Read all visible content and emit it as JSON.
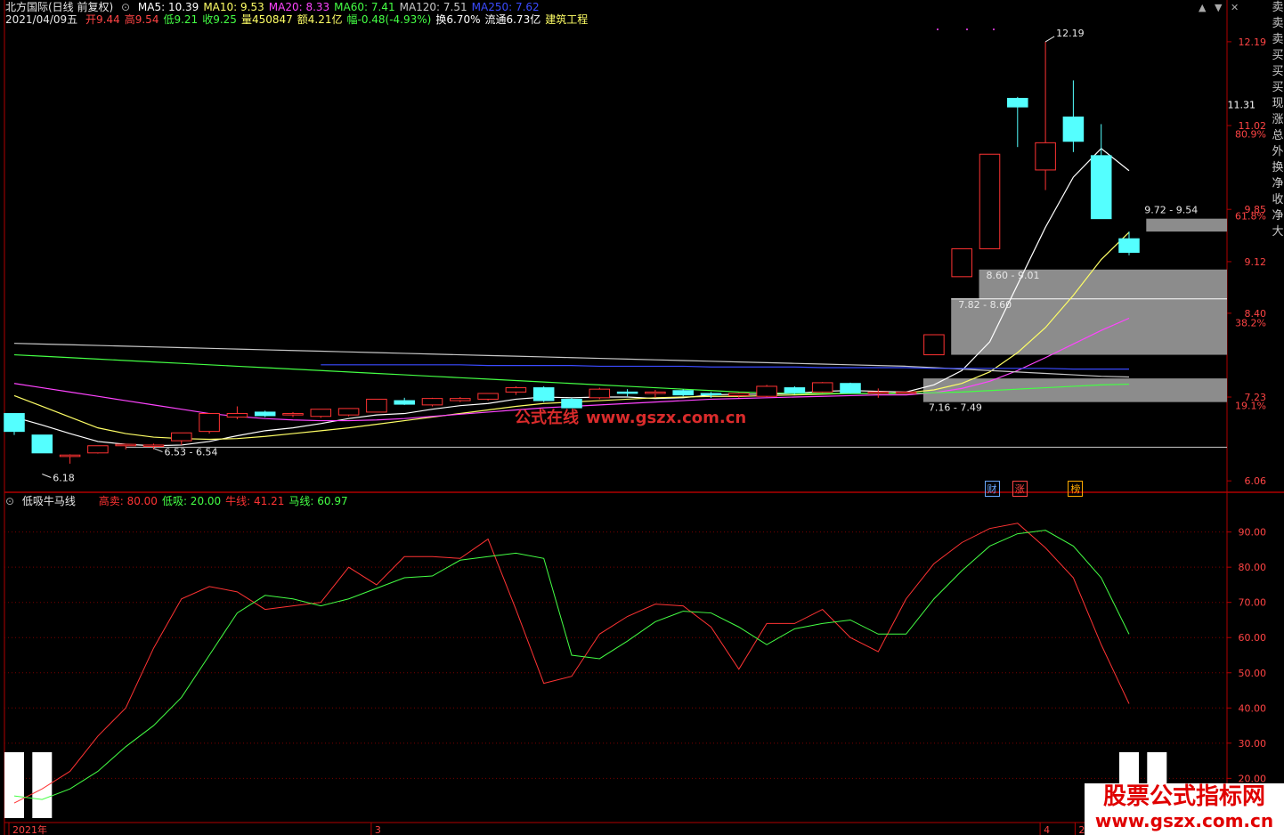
{
  "header": {
    "stock": "北方国际(日线 前复权)",
    "ma": [
      {
        "label": "MA5: 10.39",
        "color": "#ffffff"
      },
      {
        "label": "MA10: 9.53",
        "color": "#ffff66"
      },
      {
        "label": "MA20: 8.33",
        "color": "#ff44ff"
      },
      {
        "label": "MA60: 7.41",
        "color": "#44ff44"
      },
      {
        "label": "MA120: 7.51",
        "color": "#c8c8c8"
      },
      {
        "label": "MA250: 7.62",
        "color": "#3b4bff"
      }
    ],
    "info_date": "2021/04/09五",
    "info": [
      {
        "label": "开9.44",
        "color": "#ff4444"
      },
      {
        "label": "高9.54",
        "color": "#ff4444"
      },
      {
        "label": "低9.21",
        "color": "#44ff44"
      },
      {
        "label": "收9.25",
        "color": "#44ff44"
      },
      {
        "label": "量450847",
        "color": "#ffff66"
      },
      {
        "label": "额4.21亿",
        "color": "#ffff66"
      },
      {
        "label": "幅-0.48(-4.93%)",
        "color": "#44ff44"
      },
      {
        "label": "换6.70%",
        "color": "#ffffff"
      },
      {
        "label": "流通6.73亿",
        "color": "#ffffff"
      },
      {
        "label": "建筑工程",
        "color": "#ffff66"
      }
    ],
    "indicator": {
      "name": "低吸牛马线",
      "items": [
        {
          "label": "高卖: 80.00",
          "color": "#ff3333"
        },
        {
          "label": "低吸: 20.00",
          "color": "#44ff44"
        },
        {
          "label": "牛线: 41.21",
          "color": "#ff3333"
        },
        {
          "label": "马线: 60.97",
          "color": "#44ff44"
        }
      ]
    }
  },
  "right_sidebar": "卖卖卖买买买现涨总外换净收净大",
  "watermarks": {
    "center": "公式在线",
    "center_url": "www.gszx.com.cn",
    "corner_title": "股票公式指标网",
    "corner_url": "www.gszx.com.cn"
  },
  "event_tags": [
    {
      "label": "财",
      "color": "#6aa8ff"
    },
    {
      "label": "涨",
      "color": "#ff4444"
    },
    {
      "label": "榜",
      "color": "#ffaa00"
    }
  ],
  "colors": {
    "up": "#ff3333",
    "down": "#54ffff",
    "axis": "#b00000",
    "zone": "#8c8c8c"
  },
  "chart_data": [
    {
      "type": "candlestick",
      "title": "北方国际(日线 前复权)",
      "y_axis_ticks": [
        12.19,
        11.02,
        9.85,
        9.12,
        8.4,
        7.23,
        6.06
      ],
      "y_axis_current": 11.31,
      "ylim": [
        6.0,
        12.4
      ],
      "pct_ticks": [
        {
          "label": "80.9%",
          "value": 10.9
        },
        {
          "label": "61.8%",
          "value": 9.76
        },
        {
          "label": "38.2%",
          "value": 8.27
        },
        {
          "label": "19.1%",
          "value": 7.11
        }
      ],
      "x_labels": [
        {
          "label": "2021年",
          "index": 0
        },
        {
          "label": "3",
          "index": 13
        },
        {
          "label": "4",
          "index": 37
        },
        {
          "label": "2021/04/02/五",
          "index": 38
        }
      ],
      "candles": [
        {
          "o": 7.0,
          "h": 7.0,
          "l": 6.7,
          "c": 6.75
        },
        {
          "o": 6.7,
          "h": 6.7,
          "l": 6.45,
          "c": 6.45
        },
        {
          "o": 6.4,
          "h": 6.43,
          "l": 6.3,
          "c": 6.42
        },
        {
          "o": 6.45,
          "h": 6.55,
          "l": 6.44,
          "c": 6.55
        },
        {
          "o": 6.55,
          "h": 6.58,
          "l": 6.5,
          "c": 6.57
        },
        {
          "o": 6.56,
          "h": 6.58,
          "l": 6.5,
          "c": 6.56
        },
        {
          "o": 6.62,
          "h": 6.73,
          "l": 6.56,
          "c": 6.73
        },
        {
          "o": 6.75,
          "h": 7.0,
          "l": 6.72,
          "c": 7.0
        },
        {
          "o": 6.95,
          "h": 7.1,
          "l": 6.92,
          "c": 7.0
        },
        {
          "o": 7.02,
          "h": 7.04,
          "l": 6.95,
          "c": 6.97
        },
        {
          "o": 6.98,
          "h": 7.02,
          "l": 6.95,
          "c": 7.0
        },
        {
          "o": 6.96,
          "h": 7.06,
          "l": 6.94,
          "c": 7.06
        },
        {
          "o": 6.98,
          "h": 7.07,
          "l": 6.96,
          "c": 7.07
        },
        {
          "o": 7.02,
          "h": 7.2,
          "l": 7.02,
          "c": 7.2
        },
        {
          "o": 7.18,
          "h": 7.22,
          "l": 7.12,
          "c": 7.13
        },
        {
          "o": 7.12,
          "h": 7.22,
          "l": 7.1,
          "c": 7.21
        },
        {
          "o": 7.18,
          "h": 7.23,
          "l": 7.16,
          "c": 7.21
        },
        {
          "o": 7.2,
          "h": 7.28,
          "l": 7.18,
          "c": 7.28
        },
        {
          "o": 7.3,
          "h": 7.38,
          "l": 7.26,
          "c": 7.36
        },
        {
          "o": 7.36,
          "h": 7.38,
          "l": 7.16,
          "c": 7.18
        },
        {
          "o": 7.2,
          "h": 7.22,
          "l": 7.08,
          "c": 7.08
        },
        {
          "o": 7.22,
          "h": 7.36,
          "l": 7.2,
          "c": 7.34
        },
        {
          "o": 7.3,
          "h": 7.34,
          "l": 7.24,
          "c": 7.29
        },
        {
          "o": 7.28,
          "h": 7.33,
          "l": 7.22,
          "c": 7.3
        },
        {
          "o": 7.32,
          "h": 7.34,
          "l": 7.24,
          "c": 7.26
        },
        {
          "o": 7.28,
          "h": 7.3,
          "l": 7.22,
          "c": 7.27
        },
        {
          "o": 7.25,
          "h": 7.29,
          "l": 7.22,
          "c": 7.28
        },
        {
          "o": 7.24,
          "h": 7.4,
          "l": 7.23,
          "c": 7.38
        },
        {
          "o": 7.36,
          "h": 7.38,
          "l": 7.27,
          "c": 7.29
        },
        {
          "o": 7.3,
          "h": 7.44,
          "l": 7.29,
          "c": 7.43
        },
        {
          "o": 7.42,
          "h": 7.43,
          "l": 7.28,
          "c": 7.29
        },
        {
          "o": 7.3,
          "h": 7.35,
          "l": 7.22,
          "c": 7.3
        },
        {
          "o": 7.3,
          "h": 7.3,
          "l": 7.29,
          "c": 7.3
        },
        {
          "o": 7.82,
          "h": 8.1,
          "l": 7.82,
          "c": 8.1
        },
        {
          "o": 8.91,
          "h": 9.3,
          "l": 8.91,
          "c": 9.3
        },
        {
          "o": 9.3,
          "h": 10.62,
          "l": 9.3,
          "c": 10.62
        },
        {
          "o": 11.4,
          "h": 11.42,
          "l": 10.72,
          "c": 11.28
        },
        {
          "o": 10.4,
          "h": 12.19,
          "l": 10.12,
          "c": 10.78
        },
        {
          "o": 11.14,
          "h": 11.65,
          "l": 10.65,
          "c": 10.8
        },
        {
          "o": 10.6,
          "h": 11.04,
          "l": 9.72,
          "c": 9.72
        },
        {
          "o": 9.44,
          "h": 9.54,
          "l": 9.21,
          "c": 9.25
        }
      ],
      "ma_series": [
        {
          "name": "MA5",
          "color": "#ffffff",
          "start": 0,
          "values": [
            6.95,
            6.84,
            6.72,
            6.61,
            6.57,
            6.55,
            6.56,
            6.61,
            6.69,
            6.76,
            6.8,
            6.86,
            6.93,
            6.98,
            7.0,
            7.06,
            7.11,
            7.14,
            7.2,
            7.23,
            7.22,
            7.23,
            7.23,
            7.21,
            7.22,
            7.26,
            7.27,
            7.27,
            7.28,
            7.31,
            7.32,
            7.31,
            7.3,
            7.4,
            7.6,
            8.0,
            8.8,
            9.6,
            10.3,
            10.7,
            10.39
          ]
        },
        {
          "name": "MA10",
          "color": "#ffff66",
          "start": 0,
          "values": [
            7.25,
            7.1,
            6.95,
            6.8,
            6.72,
            6.67,
            6.65,
            6.64,
            6.65,
            6.68,
            6.72,
            6.76,
            6.8,
            6.85,
            6.9,
            6.95,
            7.0,
            7.05,
            7.1,
            7.14,
            7.16,
            7.18,
            7.2,
            7.22,
            7.23,
            7.24,
            7.24,
            7.25,
            7.26,
            7.27,
            7.28,
            7.28,
            7.29,
            7.33,
            7.42,
            7.58,
            7.85,
            8.2,
            8.65,
            9.15,
            9.53
          ]
        },
        {
          "name": "MA20",
          "color": "#ff44ff",
          "start": 0,
          "values": [
            7.42,
            7.36,
            7.3,
            7.24,
            7.18,
            7.12,
            7.06,
            7.0,
            6.96,
            6.93,
            6.91,
            6.9,
            6.9,
            6.91,
            6.93,
            6.96,
            6.99,
            7.02,
            7.05,
            7.08,
            7.1,
            7.12,
            7.14,
            7.16,
            7.18,
            7.2,
            7.21,
            7.22,
            7.23,
            7.24,
            7.25,
            7.26,
            7.26,
            7.29,
            7.35,
            7.45,
            7.6,
            7.78,
            7.97,
            8.16,
            8.33
          ]
        },
        {
          "name": "MA60",
          "color": "#44ff44",
          "start": 0,
          "values": [
            7.82,
            7.8,
            7.78,
            7.76,
            7.74,
            7.72,
            7.7,
            7.68,
            7.66,
            7.64,
            7.62,
            7.6,
            7.58,
            7.56,
            7.54,
            7.52,
            7.5,
            7.48,
            7.46,
            7.44,
            7.42,
            7.4,
            7.38,
            7.36,
            7.34,
            7.32,
            7.3,
            7.29,
            7.28,
            7.28,
            7.28,
            7.28,
            7.28,
            7.29,
            7.3,
            7.32,
            7.34,
            7.36,
            7.38,
            7.4,
            7.41
          ]
        },
        {
          "name": "MA120",
          "color": "#c8c8c8",
          "start": 0,
          "values": [
            7.98,
            7.97,
            7.96,
            7.95,
            7.94,
            7.93,
            7.92,
            7.91,
            7.9,
            7.89,
            7.88,
            7.87,
            7.86,
            7.85,
            7.84,
            7.83,
            7.82,
            7.81,
            7.8,
            7.79,
            7.78,
            7.77,
            7.76,
            7.75,
            7.74,
            7.73,
            7.72,
            7.71,
            7.7,
            7.69,
            7.68,
            7.67,
            7.66,
            7.64,
            7.62,
            7.6,
            7.58,
            7.56,
            7.54,
            7.52,
            7.51
          ]
        },
        {
          "name": "MA250",
          "color": "#3b4bff",
          "start": 11,
          "values": [
            7.68,
            7.68,
            7.68,
            7.68,
            7.68,
            7.68,
            7.67,
            7.67,
            7.67,
            7.67,
            7.66,
            7.66,
            7.66,
            7.66,
            7.65,
            7.65,
            7.65,
            7.65,
            7.64,
            7.64,
            7.64,
            7.64,
            7.63,
            7.63,
            7.63,
            7.63,
            7.63,
            7.62,
            7.62,
            7.62
          ]
        }
      ],
      "zones": [
        {
          "label": "7.16 - 7.49",
          "low": 7.16,
          "high": 7.49,
          "start": 33
        },
        {
          "label": "7.82 - 8.60",
          "low": 7.82,
          "high": 8.6,
          "start": 34
        },
        {
          "label": "8.60 - 9.01",
          "low": 8.6,
          "high": 9.01,
          "start": 35
        },
        {
          "label": "9.72 - 9.54",
          "low": 9.54,
          "high": 9.72,
          "start": 41
        }
      ],
      "annotations": [
        {
          "label": "12.19",
          "index": 37,
          "value": 12.19
        },
        {
          "label": "6.53 - 6.54",
          "index": 5,
          "value": 6.54
        },
        {
          "label": "6.18",
          "index": 1,
          "value": 6.18
        }
      ],
      "support_line": 6.53
    },
    {
      "type": "line",
      "title": "低吸牛马线",
      "y_axis_ticks": [
        90,
        80,
        70,
        60,
        50,
        40,
        30,
        20
      ],
      "ylim": [
        12,
        98
      ],
      "levels": {
        "高卖": 80.0,
        "低吸": 20.0
      },
      "series": [
        {
          "name": "牛线",
          "color": "#ff3333",
          "values": [
            13,
            17,
            22,
            32,
            40,
            57,
            71,
            74.5,
            73,
            68,
            69,
            70,
            80,
            75,
            83,
            83,
            82.5,
            88,
            68,
            47,
            49,
            61,
            66,
            69.5,
            69,
            63,
            51,
            64,
            64,
            68,
            60,
            56,
            71,
            81,
            87,
            91,
            92.5,
            85.5,
            77,
            58,
            41.21
          ]
        },
        {
          "name": "马线",
          "color": "#44ff44",
          "values": [
            15,
            14,
            17,
            22,
            29,
            35,
            43,
            55,
            67,
            72,
            71,
            69,
            71,
            74,
            77,
            77.5,
            82,
            83,
            84,
            82.5,
            55,
            54,
            59,
            64.5,
            67.5,
            67,
            63,
            58,
            62.5,
            64,
            65,
            61,
            61,
            71,
            79,
            86,
            89.5,
            90.5,
            86,
            77,
            60.97
          ]
        }
      ],
      "signal_bars": [
        0,
        1,
        40,
        41
      ]
    }
  ]
}
